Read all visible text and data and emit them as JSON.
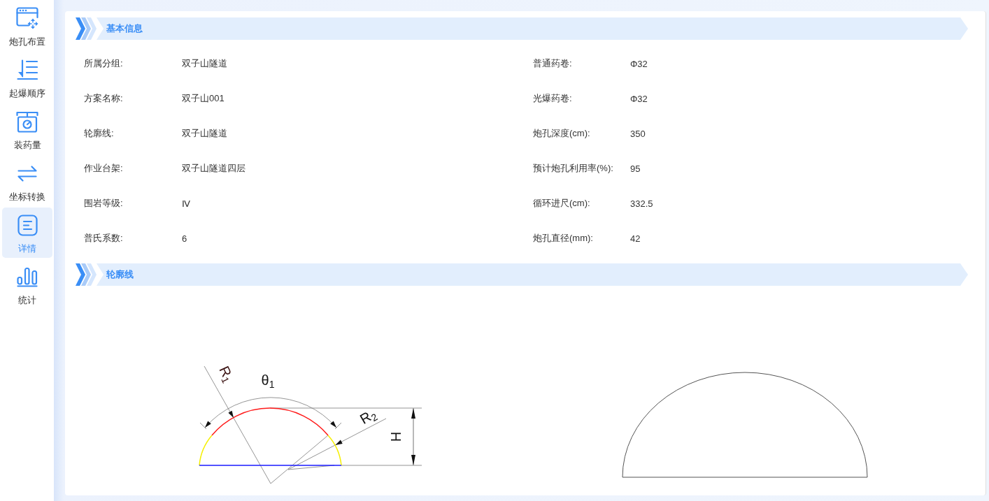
{
  "sidebar": {
    "items": [
      {
        "label": "炮孔布置",
        "selected": false
      },
      {
        "label": "起爆顺序",
        "selected": false
      },
      {
        "label": "装药量",
        "selected": false
      },
      {
        "label": "坐标转换",
        "selected": false
      },
      {
        "label": "详情",
        "selected": true
      },
      {
        "label": "统计",
        "selected": false
      }
    ]
  },
  "basic_info": {
    "title": "基本信息",
    "fields": [
      {
        "label": "所属分组:",
        "value": "双子山隧道"
      },
      {
        "label": "普通药卷:",
        "value": "Φ32"
      },
      {
        "label": "方案名称:",
        "value": "双子山001"
      },
      {
        "label": "光爆药卷:",
        "value": "Φ32"
      },
      {
        "label": "轮廓线:",
        "value": "双子山隧道"
      },
      {
        "label": "炮孔深度(cm):",
        "value": "350"
      },
      {
        "label": "作业台架:",
        "value": "双子山隧道四层"
      },
      {
        "label": "预计炮孔利用率(%):",
        "value": "95"
      },
      {
        "label": "围岩等级:",
        "value": "Ⅳ"
      },
      {
        "label": "循环进尺(cm):",
        "value": "332.5"
      },
      {
        "label": "普氏系数:",
        "value": "6"
      },
      {
        "label": "炮孔直径(mm):",
        "value": "42"
      }
    ]
  },
  "profile": {
    "title": "轮廓线",
    "dimension_labels": [
      "R$_{1}$",
      "θ$_{1}$",
      "R$_{2}$",
      "H"
    ]
  }
}
